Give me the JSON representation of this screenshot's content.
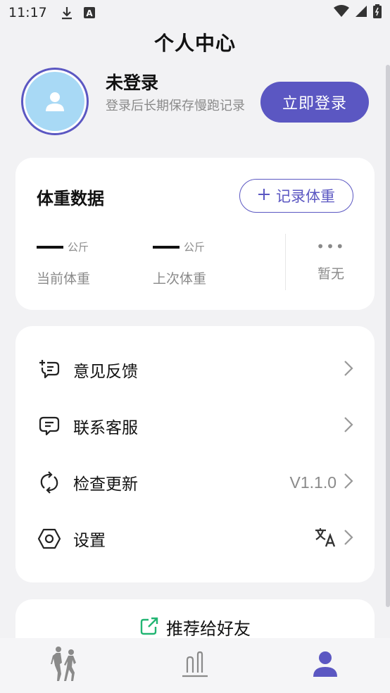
{
  "status_bar": {
    "time": "11:17"
  },
  "header": {
    "title": "个人中心"
  },
  "profile": {
    "name": "未登录",
    "hint": "登录后长期保存慢跑记录",
    "login_button": "立即登录"
  },
  "weight": {
    "title": "体重数据",
    "record_button": "记录体重",
    "current": {
      "value": "—",
      "unit": "公斤",
      "label": "当前体重"
    },
    "previous": {
      "value": "—",
      "unit": "公斤",
      "label": "上次体重"
    },
    "more": {
      "dots": "•••",
      "label": "暂无"
    }
  },
  "menu": {
    "items": [
      {
        "label": "意见反馈",
        "icon": "feedback-icon"
      },
      {
        "label": "联系客服",
        "icon": "chat-icon"
      },
      {
        "label": "检查更新",
        "icon": "refresh-icon",
        "value": "V1.1.0"
      },
      {
        "label": "设置",
        "icon": "hexagon-settings-icon"
      }
    ]
  },
  "share": {
    "label": "推荐给好友",
    "icon": "external-link-icon"
  },
  "tabs": [
    {
      "name": "running",
      "icon": "runners-icon"
    },
    {
      "name": "stats",
      "icon": "bar-chart-icon"
    },
    {
      "name": "profile",
      "icon": "user-icon",
      "active": true
    }
  ],
  "colors": {
    "accent": "#5b57c2",
    "share_icon": "#22b573",
    "avatar_bg": "#a8d9f5"
  }
}
